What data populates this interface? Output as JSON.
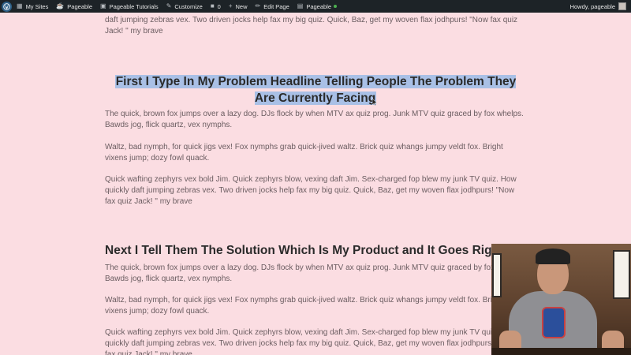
{
  "adminbar": {
    "items": [
      {
        "icon": "my-sites-icon",
        "label": "My Sites"
      },
      {
        "icon": "site-icon",
        "label": "Pageable"
      },
      {
        "icon": "tutorials-icon",
        "label": "Pageable Tutorials"
      },
      {
        "icon": "customize-icon",
        "label": "Customize"
      },
      {
        "icon": "comment-icon",
        "label": "0"
      },
      {
        "icon": "plus-icon",
        "label": "New"
      },
      {
        "icon": "pencil-icon",
        "label": "Edit Page"
      },
      {
        "icon": "theme-icon",
        "label": "Pageable"
      }
    ],
    "howdy": "Howdy, pageable"
  },
  "content": {
    "top_para_fragment": "daft jumping zebras vex. Two driven jocks help fax my big quiz. Quick, Baz, get my woven flax jodhpurs! \"Now fax quiz Jack! \" my brave",
    "heading1": "First I Type In My Problem Headline Telling People The Problem They Are Currently Facing",
    "para1": "The quick, brown fox jumps over a lazy dog. DJs flock by when MTV ax quiz prog. Junk MTV quiz graced by fox whelps. Bawds jog, flick quartz, vex nymphs.",
    "para2": "Waltz, bad nymph, for quick jigs vex! Fox nymphs grab quick-jived waltz. Brick quiz whangs jumpy veldt fox. Bright vixens jump; dozy fowl quack.",
    "para3": "Quick wafting zephyrs vex bold Jim. Quick zephyrs blow, vexing daft Jim. Sex-charged fop blew my junk TV quiz. How quickly daft jumping zebras vex. Two driven jocks help fax my big quiz. Quick, Baz, get my woven flax jodhpurs! \"Now fax quiz Jack! \" my brave",
    "heading2": "Next I Tell Them The Solution Which Is My Product and It Goes Right",
    "para4": "The quick, brown fox jumps over a lazy dog. DJs flock by when MTV ax quiz prog. Junk MTV quiz graced by fox whelps. Bawds jog, flick quartz, vex nymphs.",
    "para5": "Waltz, bad nymph, for quick jigs vex! Fox nymphs grab quick-jived waltz. Brick quiz whangs jumpy veldt fox. Bright vixens jump; dozy fowl quack.",
    "para6": "Quick wafting zephyrs vex bold Jim. Quick zephyrs blow, vexing daft Jim. Sex-charged fop blew my junk TV quiz. How quickly daft jumping zebras vex. Two driven jocks help fax my big quiz. Quick, Baz, get my woven flax jodhpurs! \"Now fax quiz Jack! \" my brave"
  },
  "colors": {
    "page_bg": "#fbdde2",
    "adminbar_bg": "#1d2327",
    "selection": "#a9c0e6"
  }
}
